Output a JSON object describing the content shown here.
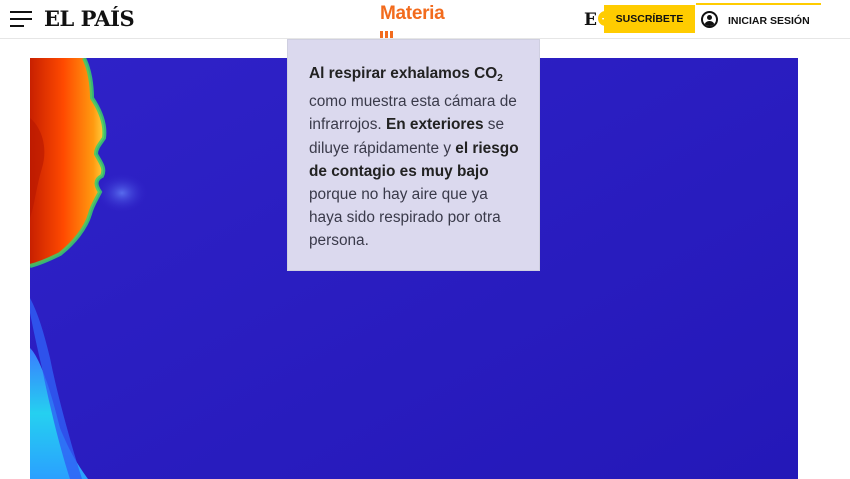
{
  "header": {
    "logo": "EL PAÍS",
    "section": "Materia",
    "eplus_letter": "E",
    "eplus_symbol": "+",
    "subscribe_label": "SUSCRÍBETE",
    "login_label": "INICIAR SESIÓN"
  },
  "caption": {
    "line1": "Al respirar exhalamos CO",
    "line1_sub": "2",
    "t1": " como muestra esta cámara de infrarrojos. ",
    "b1": "En exteriores",
    "t2": " se diluye rápidamente y ",
    "b2": "el riesgo de contagio es muy bajo",
    "t3": " porque no hay aire que ya haya sido respirado por otra persona."
  },
  "colors": {
    "section_accent": "#f26b1d",
    "subscribe_bg": "#ffcc00",
    "thermal_background": "#2a1fc0",
    "caption_bg": "#dbd9ee"
  },
  "icons": [
    "menu-icon",
    "eplus-icon",
    "user-icon"
  ],
  "hero": {
    "image": "infrared-thermal-profile"
  }
}
